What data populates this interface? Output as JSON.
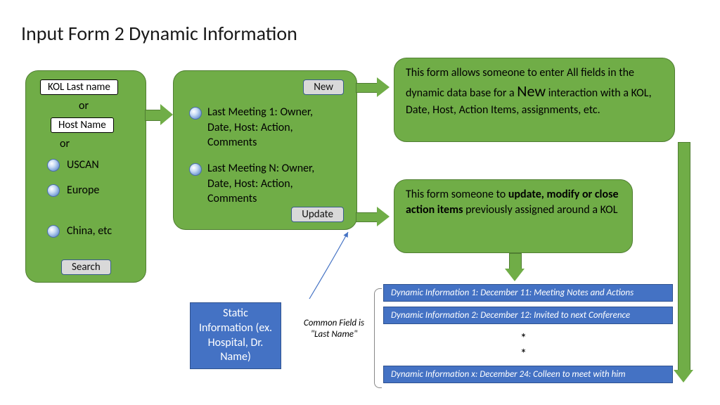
{
  "title": "Input Form 2  Dynamic Information",
  "search_box": {
    "field1": "KOL Last name",
    "or1": "or",
    "field2": "Host Name",
    "or2": "or",
    "opt1": "USCAN",
    "opt2": "Europe",
    "opt3": "China, etc",
    "search_btn": "Search"
  },
  "meetings_box": {
    "new_btn": "New",
    "line1": "Last Meeting 1: Owner, Date, Host: Action, Comments",
    "line2": "Last Meeting N: Owner, Date, Host: Action, Comments",
    "update_btn": "Update"
  },
  "info_new": {
    "pre": "This form allows someone to enter All fields in the dynamic data base for a ",
    "big": "New",
    "post": " interaction with a KOL, Date, Host, Action Items, assignments, etc."
  },
  "info_update": {
    "pre": "This form someone to ",
    "bold": "update, modify or close action items",
    "post": " previously assigned around a KOL"
  },
  "static_box": "Static Information (ex. Hospital, Dr. Name)",
  "common_field": "Common Field is \"Last Name\"",
  "dyn1": "Dynamic Information 1:  December 11: Meeting Notes and Actions",
  "dyn2": "Dynamic Information 2:  December 12: Invited to next Conference",
  "dynx": "Dynamic Information x:  December 24:  Colleen to meet with him",
  "star": "*"
}
